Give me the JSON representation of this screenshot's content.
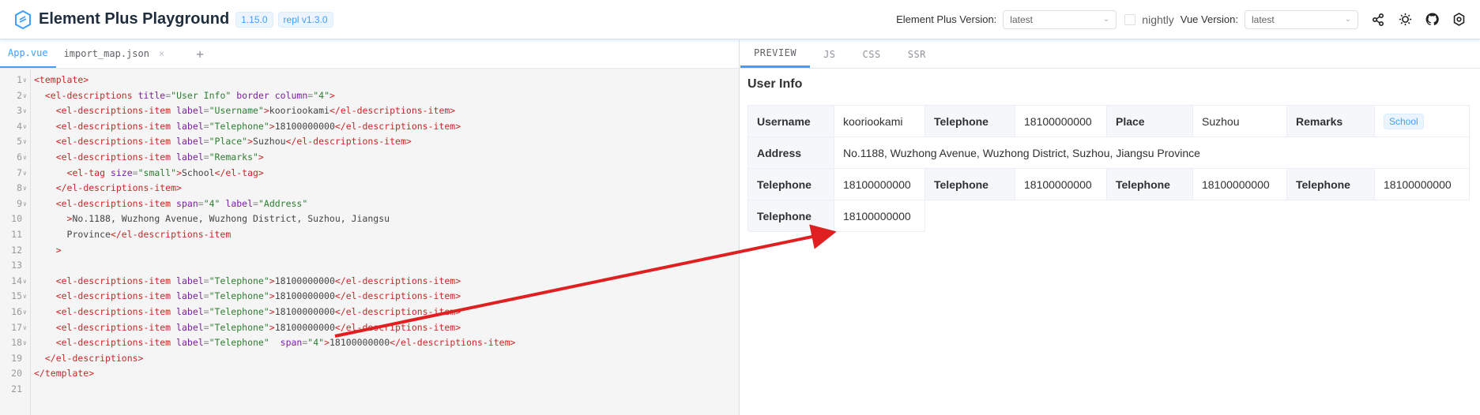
{
  "header": {
    "title": "Element Plus Playground",
    "version_badge": "1.15.0",
    "repl_badge": "repl v1.3.0",
    "ep_version_label": "Element Plus Version:",
    "ep_version_value": "latest",
    "nightly_label": "nightly",
    "vue_version_label": "Vue Version:",
    "vue_version_value": "latest",
    "icons": [
      "share-icon",
      "sun-icon",
      "github-icon",
      "settings-icon"
    ]
  },
  "editor": {
    "tabs": [
      {
        "label": "App.vue",
        "active": true
      },
      {
        "label": "import_map.json",
        "active": false
      }
    ],
    "add_tab": "+",
    "close_glyph": "×",
    "line_numbers": [
      "1",
      "2",
      "3",
      "4",
      "5",
      "6",
      "7",
      "8",
      "9",
      "10",
      "11",
      "12",
      "13",
      "14",
      "15",
      "16",
      "17",
      "18",
      "19",
      "20",
      "21"
    ],
    "lines": [
      [
        [
          "tag",
          "<template>"
        ]
      ],
      [
        [
          "txt",
          "  "
        ],
        [
          "tag",
          "<el-descriptions"
        ],
        [
          "txt",
          " "
        ],
        [
          "attr",
          "title"
        ],
        [
          "punc",
          "="
        ],
        [
          "str",
          "\"User Info\""
        ],
        [
          "txt",
          " "
        ],
        [
          "attr",
          "border"
        ],
        [
          "txt",
          " "
        ],
        [
          "attr",
          "column"
        ],
        [
          "punc",
          "="
        ],
        [
          "str",
          "\"4\""
        ],
        [
          "tag",
          ">"
        ]
      ],
      [
        [
          "txt",
          "    "
        ],
        [
          "tag",
          "<el-descriptions-item"
        ],
        [
          "txt",
          " "
        ],
        [
          "attr",
          "label"
        ],
        [
          "punc",
          "="
        ],
        [
          "str",
          "\"Username\""
        ],
        [
          "tag",
          ">"
        ],
        [
          "txt",
          "kooriookami"
        ],
        [
          "tag",
          "</el-descriptions-item>"
        ]
      ],
      [
        [
          "txt",
          "    "
        ],
        [
          "tag",
          "<el-descriptions-item"
        ],
        [
          "txt",
          " "
        ],
        [
          "attr",
          "label"
        ],
        [
          "punc",
          "="
        ],
        [
          "str",
          "\"Telephone\""
        ],
        [
          "tag",
          ">"
        ],
        [
          "txt",
          "18100000000"
        ],
        [
          "tag",
          "</el-descriptions-item>"
        ]
      ],
      [
        [
          "txt",
          "    "
        ],
        [
          "tag",
          "<el-descriptions-item"
        ],
        [
          "txt",
          " "
        ],
        [
          "attr",
          "label"
        ],
        [
          "punc",
          "="
        ],
        [
          "str",
          "\"Place\""
        ],
        [
          "tag",
          ">"
        ],
        [
          "txt",
          "Suzhou"
        ],
        [
          "tag",
          "</el-descriptions-item>"
        ]
      ],
      [
        [
          "txt",
          "    "
        ],
        [
          "tag",
          "<el-descriptions-item"
        ],
        [
          "txt",
          " "
        ],
        [
          "attr",
          "label"
        ],
        [
          "punc",
          "="
        ],
        [
          "str",
          "\"Remarks\""
        ],
        [
          "tag",
          ">"
        ]
      ],
      [
        [
          "txt",
          "      "
        ],
        [
          "tag",
          "<el-tag"
        ],
        [
          "txt",
          " "
        ],
        [
          "attr",
          "size"
        ],
        [
          "punc",
          "="
        ],
        [
          "str",
          "\"small\""
        ],
        [
          "tag",
          ">"
        ],
        [
          "txt",
          "School"
        ],
        [
          "tag",
          "</el-tag>"
        ]
      ],
      [
        [
          "txt",
          "    "
        ],
        [
          "tag",
          "</el-descriptions-item>"
        ]
      ],
      [
        [
          "txt",
          "    "
        ],
        [
          "tag",
          "<el-descriptions-item"
        ],
        [
          "txt",
          " "
        ],
        [
          "attr",
          "span"
        ],
        [
          "punc",
          "="
        ],
        [
          "str",
          "\"4\""
        ],
        [
          "txt",
          " "
        ],
        [
          "attr",
          "label"
        ],
        [
          "punc",
          "="
        ],
        [
          "str",
          "\"Address\""
        ]
      ],
      [
        [
          "txt",
          "      "
        ],
        [
          "tag",
          ">"
        ],
        [
          "txt",
          "No.1188, Wuzhong Avenue, Wuzhong District, Suzhou, Jiangsu"
        ]
      ],
      [
        [
          "txt",
          "      Province"
        ],
        [
          "tag",
          "</el-descriptions-item"
        ]
      ],
      [
        [
          "txt",
          "    "
        ],
        [
          "tag",
          ">"
        ]
      ],
      [],
      [
        [
          "txt",
          "    "
        ],
        [
          "tag",
          "<el-descriptions-item"
        ],
        [
          "txt",
          " "
        ],
        [
          "attr",
          "label"
        ],
        [
          "punc",
          "="
        ],
        [
          "str",
          "\"Telephone\""
        ],
        [
          "tag",
          ">"
        ],
        [
          "txt",
          "18100000000"
        ],
        [
          "tag",
          "</el-descriptions-item>"
        ]
      ],
      [
        [
          "txt",
          "    "
        ],
        [
          "tag",
          "<el-descriptions-item"
        ],
        [
          "txt",
          " "
        ],
        [
          "attr",
          "label"
        ],
        [
          "punc",
          "="
        ],
        [
          "str",
          "\"Telephone\""
        ],
        [
          "tag",
          ">"
        ],
        [
          "txt",
          "18100000000"
        ],
        [
          "tag",
          "</el-descriptions-item>"
        ]
      ],
      [
        [
          "txt",
          "    "
        ],
        [
          "tag",
          "<el-descriptions-item"
        ],
        [
          "txt",
          " "
        ],
        [
          "attr",
          "label"
        ],
        [
          "punc",
          "="
        ],
        [
          "str",
          "\"Telephone\""
        ],
        [
          "tag",
          ">"
        ],
        [
          "txt",
          "18100000000"
        ],
        [
          "tag",
          "</el-descriptions-item>"
        ]
      ],
      [
        [
          "txt",
          "    "
        ],
        [
          "tag",
          "<el-descriptions-item"
        ],
        [
          "txt",
          " "
        ],
        [
          "attr",
          "label"
        ],
        [
          "punc",
          "="
        ],
        [
          "str",
          "\"Telephone\""
        ],
        [
          "tag",
          ">"
        ],
        [
          "txt",
          "18100000000"
        ],
        [
          "tag",
          "</el-descriptions-item>"
        ]
      ],
      [
        [
          "txt",
          "    "
        ],
        [
          "tag",
          "<el-descriptions-item"
        ],
        [
          "txt",
          " "
        ],
        [
          "attr",
          "label"
        ],
        [
          "punc",
          "="
        ],
        [
          "str",
          "\"Telephone\""
        ],
        [
          "txt",
          "  "
        ],
        [
          "attr",
          "span"
        ],
        [
          "punc",
          "="
        ],
        [
          "str",
          "\"4\""
        ],
        [
          "tag",
          ">"
        ],
        [
          "txt",
          "18100000000"
        ],
        [
          "tag",
          "</el-descriptions-item>"
        ]
      ],
      [
        [
          "txt",
          "  "
        ],
        [
          "tag",
          "</el-descriptions>"
        ]
      ],
      [
        [
          "tag",
          "</template>"
        ]
      ],
      []
    ],
    "foldable_lines": [
      1,
      2,
      3,
      4,
      5,
      6,
      7,
      8,
      9,
      14,
      15,
      16,
      17,
      18
    ]
  },
  "preview": {
    "tabs": [
      "PREVIEW",
      "JS",
      "CSS",
      "SSR"
    ],
    "title": "User Info",
    "rows": [
      [
        {
          "label": "Username",
          "value": "kooriookami"
        },
        {
          "label": "Telephone",
          "value": "18100000000"
        },
        {
          "label": "Place",
          "value": "Suzhou"
        },
        {
          "label": "Remarks",
          "tag": "School"
        }
      ],
      [
        {
          "label": "Address",
          "value": "No.1188, Wuzhong Avenue, Wuzhong District, Suzhou, Jiangsu Province",
          "span": 7
        }
      ],
      [
        {
          "label": "Telephone",
          "value": "18100000000"
        },
        {
          "label": "Telephone",
          "value": "18100000000"
        },
        {
          "label": "Telephone",
          "value": "18100000000"
        },
        {
          "label": "Telephone",
          "value": "18100000000"
        }
      ],
      [
        {
          "label": "Telephone",
          "value": "18100000000"
        }
      ]
    ]
  },
  "colors": {
    "accent": "#409eff",
    "annotation_arrow": "#e02020"
  }
}
